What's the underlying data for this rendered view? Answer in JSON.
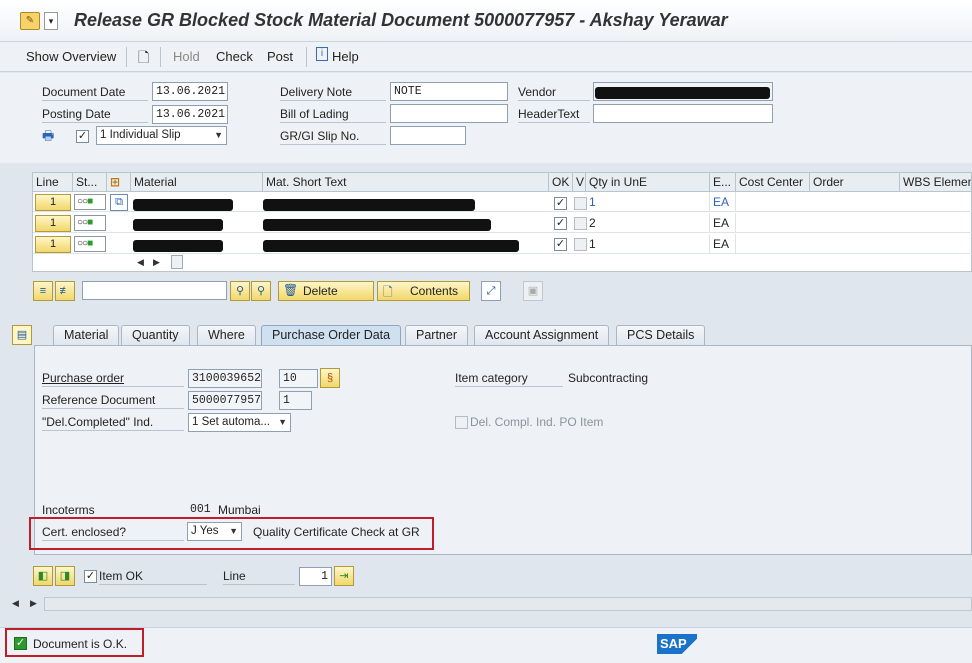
{
  "window": {
    "title": "Release GR Blocked Stock Material Document 5000077957 - Akshay Yerawar"
  },
  "toolbar": {
    "show_overview": "Show Overview",
    "hold": "Hold",
    "check": "Check",
    "post": "Post",
    "help": "Help"
  },
  "header": {
    "document_date_label": "Document Date",
    "document_date": "13.06.2021",
    "posting_date_label": "Posting Date",
    "posting_date": "13.06.2021",
    "slip_option": "1 Individual Slip",
    "delivery_note_label": "Delivery Note",
    "delivery_note": "NOTE",
    "bill_of_lading_label": "Bill of Lading",
    "bill_of_lading": "",
    "gr_gi_slip_label": "GR/GI Slip No.",
    "gr_gi_slip": "",
    "vendor_label": "Vendor",
    "header_text_label": "HeaderText",
    "header_text": ""
  },
  "items_table": {
    "columns": [
      "Line",
      "St...",
      "Material",
      "Mat. Short Text",
      "OK",
      "V",
      "Qty in UnE",
      "E...",
      "Cost Center",
      "Order",
      "WBS Element"
    ],
    "rows": [
      {
        "line": "1",
        "ok": "✓",
        "qty": "1",
        "unit": "EA"
      },
      {
        "line": "1",
        "ok": "✓",
        "qty": "2",
        "unit": "EA"
      },
      {
        "line": "1",
        "ok": "✓",
        "qty": "1",
        "unit": "EA"
      }
    ]
  },
  "item_actions": {
    "delete": "Delete",
    "contents": "Contents"
  },
  "tabs": [
    "Material",
    "Quantity",
    "Where",
    "Purchase Order Data",
    "Partner",
    "Account Assignment",
    "PCS Details"
  ],
  "po_data": {
    "purchase_order_label": "Purchase order",
    "purchase_order": "3100039652",
    "po_item": "10",
    "reference_document_label": "Reference Document",
    "reference_document": "5000077957",
    "reference_item": "1",
    "del_completed_label": "\"Del.Completed\" Ind.",
    "del_completed": "1 Set automa...",
    "item_category_label": "Item category",
    "item_category": "Subcontracting",
    "del_compl_po_label": "Del. Compl. Ind. PO Item",
    "incoterms_label": "Incoterms",
    "incoterms_code": "001",
    "incoterms_place": "Mumbai",
    "cert_enclosed_label": "Cert. enclosed?",
    "cert_enclosed": "J Yes",
    "cert_description": "Quality Certificate Check at GR"
  },
  "footer": {
    "item_ok_label": "Item OK",
    "line_label": "Line",
    "line_value": "1"
  },
  "status": {
    "message": "Document is O.K.",
    "logo": "SAP"
  }
}
